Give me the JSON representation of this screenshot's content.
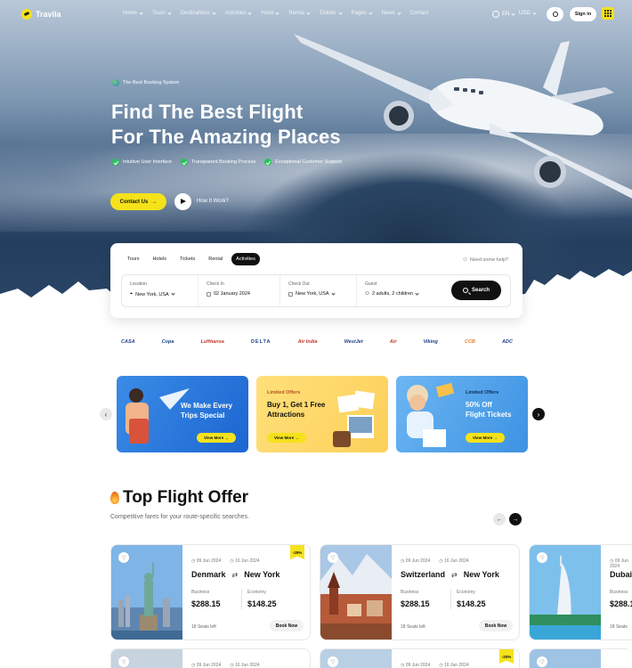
{
  "nav": {
    "logo": "Travila",
    "menu": [
      "Home",
      "Tours",
      "Destinations",
      "Activities",
      "Hotel",
      "Rental",
      "Tickets",
      "Pages",
      "News",
      "Contact"
    ],
    "menu_has_chevron": [
      true,
      true,
      true,
      true,
      true,
      true,
      true,
      true,
      true,
      false
    ],
    "language": "EN",
    "currency": "USD",
    "signin": "Sign in"
  },
  "hero": {
    "badge": "The Best Booking System",
    "title_line1": "Find The Best Flight",
    "title_line2": "For The Amazing Places",
    "features": [
      "Intuitive User Interface",
      "Transparent Booking Process",
      "Exceptional Customer Support"
    ],
    "contact_btn": "Contact Us",
    "how": "How It Work?"
  },
  "search": {
    "tabs": [
      "Tours",
      "Hotels",
      "Tickets",
      "Rental",
      "Activities"
    ],
    "active_tab": "Activities",
    "help": "Need some help?",
    "fields": [
      {
        "label": "Location",
        "value": "New York, USA"
      },
      {
        "label": "Check In",
        "value": "02 January 2024"
      },
      {
        "label": "Check Out",
        "value": "New York, USA"
      },
      {
        "label": "Guest",
        "value": "2 adults, 2 children"
      }
    ],
    "button": "Search"
  },
  "brands": [
    "CASA",
    "Copa",
    "Lufthansa",
    "DELTA",
    "Air India",
    "WestJet",
    "Air",
    "Viking",
    "CCB",
    "ADC"
  ],
  "promos": [
    {
      "tag": "",
      "title_line1": "We Make Every",
      "title_line2": "Trips Special",
      "title_line3": "",
      "button": "View More"
    },
    {
      "tag": "Limited Offers",
      "title_line1": "Buy 1, Get 1 Free",
      "title_line2": "Attractions",
      "title_line3": "",
      "button": "View More"
    },
    {
      "tag": "Limited Offers",
      "title_line1": "50% Off",
      "title_line2": "Flight Tickets",
      "title_line3": "",
      "button": "View More"
    }
  ],
  "section": {
    "title": "Top Flight Offer",
    "subtitle": "Competitive fares for your route-specific searches."
  },
  "flights": [
    {
      "date_from": "09 Jun 2024",
      "date_to": "16 Jun 2024",
      "from": "Denmark",
      "to": "New York",
      "class1": "Business",
      "price1": "$288.15",
      "class2": "Economy",
      "price2": "$148.25",
      "seats": "18 Seats left",
      "book": "Book Now",
      "discount": "-25%"
    },
    {
      "date_from": "09 Jun 2024",
      "date_to": "16 Jun 2024",
      "from": "Switzerland",
      "to": "New York",
      "class1": "Business",
      "price1": "$288.15",
      "class2": "Economy",
      "price2": "$148.25",
      "seats": "18 Seats left",
      "book": "Book Now",
      "discount": ""
    },
    {
      "date_from": "09 Jun 2024",
      "date_to": "",
      "from": "Dubai",
      "to": "",
      "class1": "Business",
      "price1": "$288.1",
      "class2": "",
      "price2": "",
      "seats": "18 Seats",
      "book": "",
      "discount": ""
    }
  ],
  "flights_row2": {
    "discount": "-20%"
  }
}
